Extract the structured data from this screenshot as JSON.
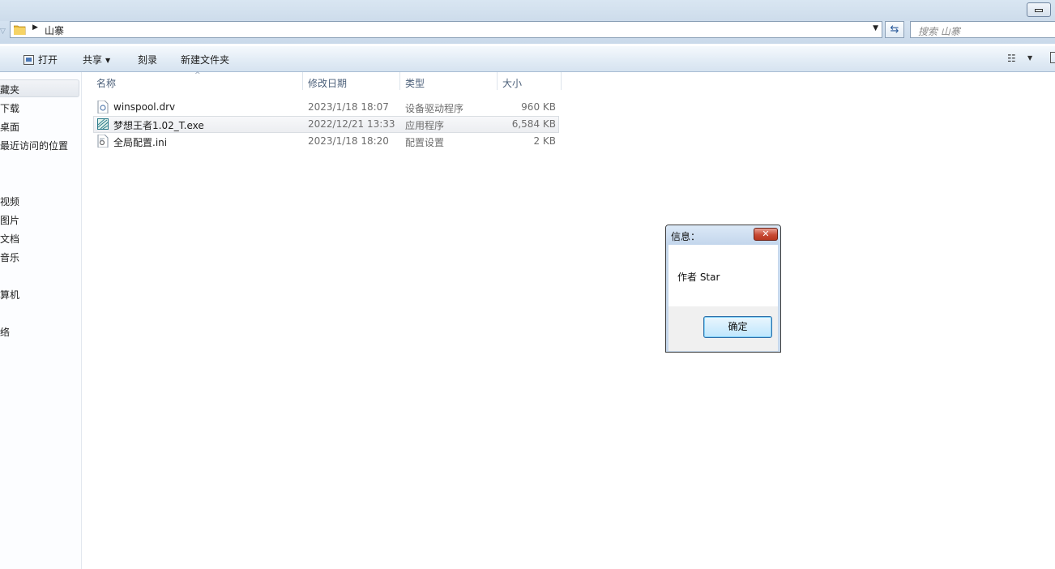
{
  "address": {
    "path": "山寨",
    "search_placeholder": "搜索 山寨"
  },
  "toolbar": {
    "open": "打开",
    "share": "共享",
    "burn": "刻录",
    "new_folder": "新建文件夹"
  },
  "nav": {
    "items": [
      "藏夹",
      "下载",
      "桌面",
      "最近访问的位置",
      "视频",
      "图片",
      "文档",
      "音乐",
      "算机",
      "络"
    ]
  },
  "columns": {
    "name": "名称",
    "date": "修改日期",
    "type": "类型",
    "size": "大小"
  },
  "files": [
    {
      "name": "winspool.drv",
      "date": "2023/1/18 18:07",
      "type": "设备驱动程序",
      "size": "960 KB",
      "icon": "driver-icon"
    },
    {
      "name": "梦想王者1.02_T.exe",
      "date": "2022/12/21 13:33",
      "type": "应用程序",
      "size": "6,584 KB",
      "icon": "exe-icon"
    },
    {
      "name": "全局配置.ini",
      "date": "2023/1/18 18:20",
      "type": "配置设置",
      "size": "2 KB",
      "icon": "ini-icon"
    }
  ],
  "dialog": {
    "title": "信息：",
    "message": "作者 Star",
    "ok": "确定",
    "close": "✕"
  },
  "colors": {
    "accent": "#2f6fa8",
    "close_red": "#c84a35"
  }
}
